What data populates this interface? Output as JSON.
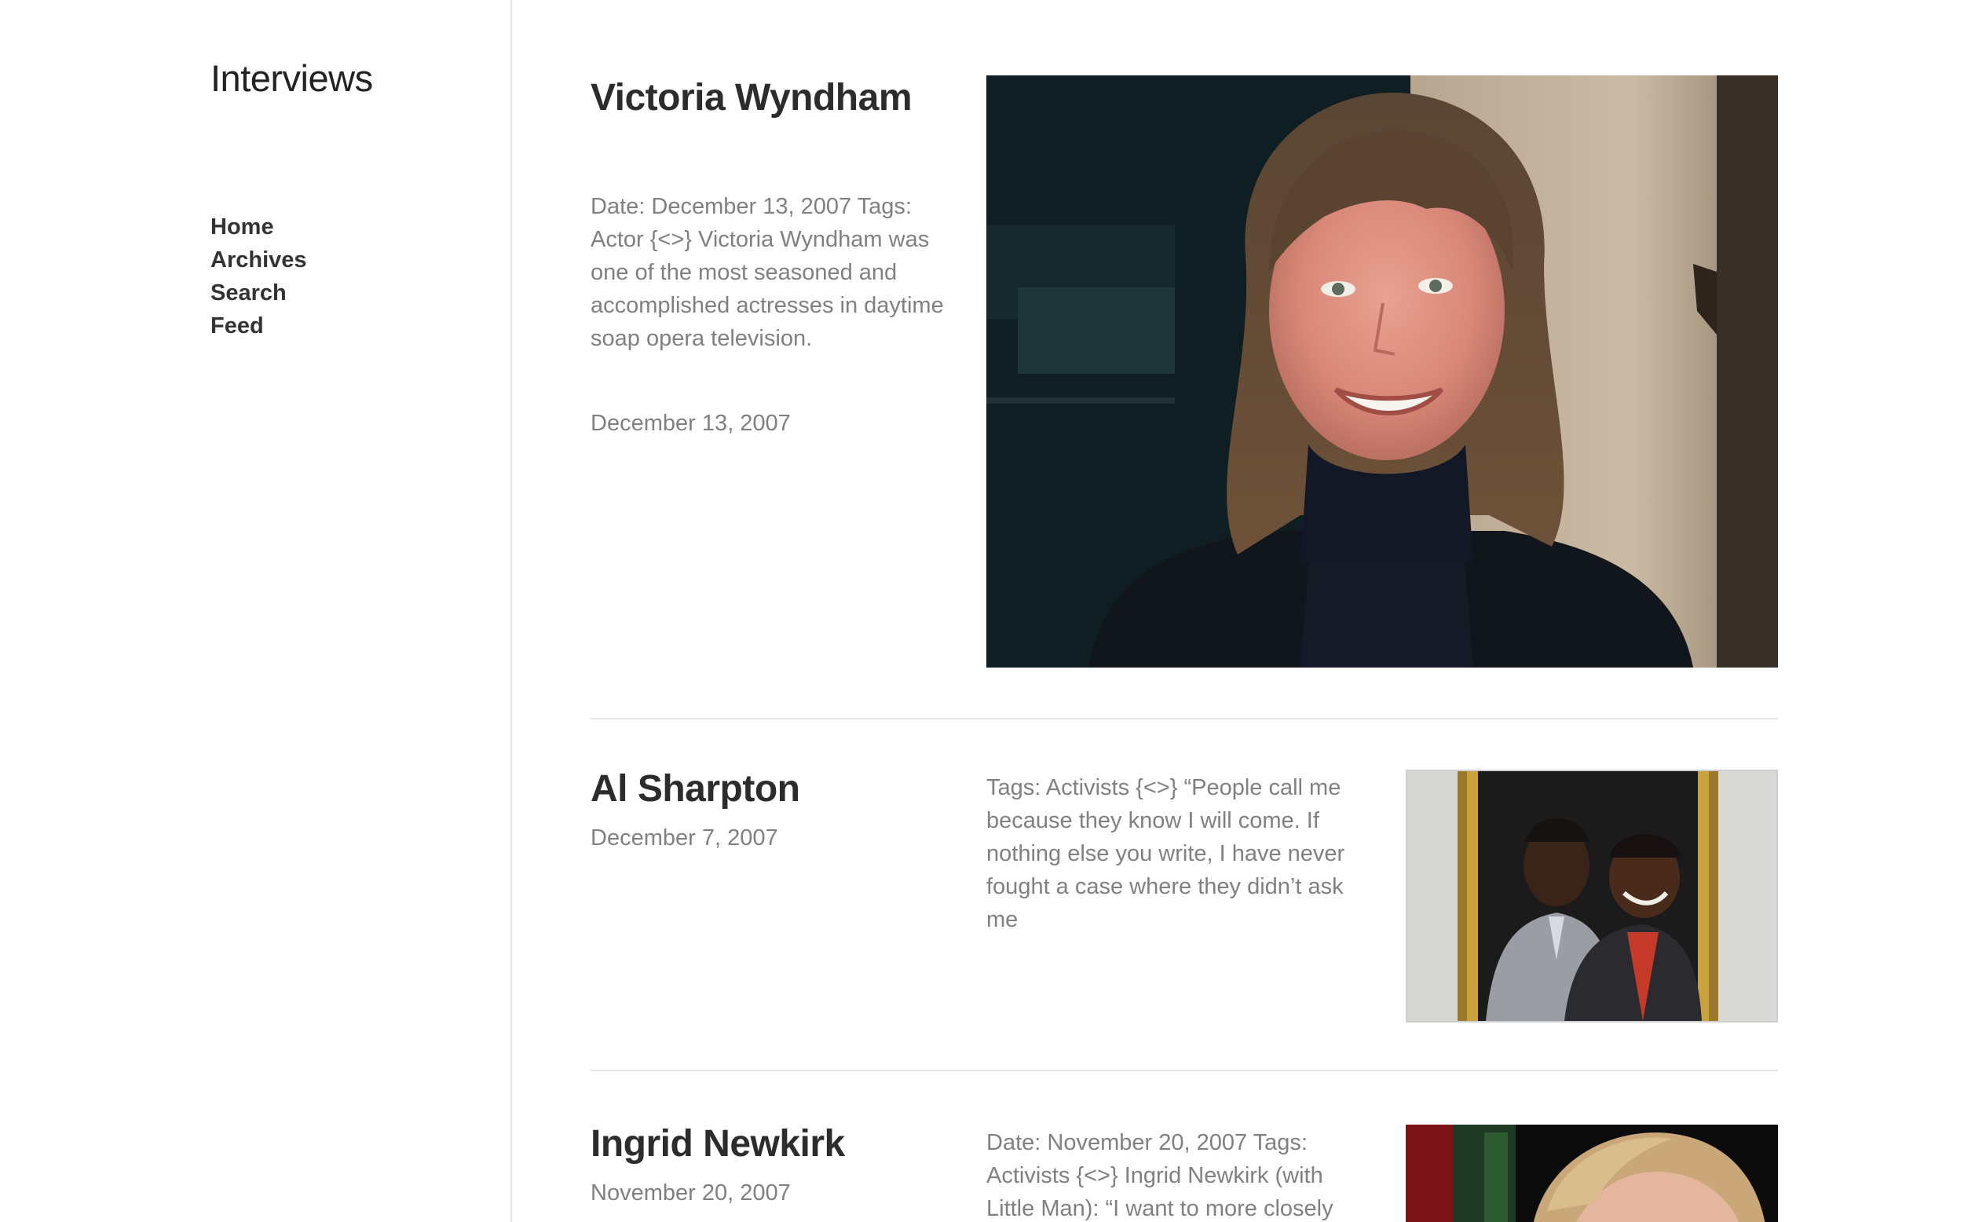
{
  "site": {
    "title": "Interviews"
  },
  "nav": {
    "items": [
      {
        "label": "Home"
      },
      {
        "label": "Archives"
      },
      {
        "label": "Search"
      },
      {
        "label": "Feed"
      }
    ]
  },
  "posts": [
    {
      "title": "Victoria Wyndham",
      "excerpt": "Date: December 13, 2007 Tags: Actor {<>} Victoria Wyndham was one of the most seasoned and accomplished actresses in daytime soap opera television.",
      "date": "December 13, 2007",
      "image": "portrait photo of a smiling woman with shoulder-length brown hair and bangs"
    },
    {
      "title": "Al Sharpton",
      "date": "December 7, 2007",
      "excerpt": "Tags: Activists {<>} “People call me because they know I will come. If nothing else you write, I have never fought a case where they didn’t ask me",
      "image": "framed photo of two men in suits"
    },
    {
      "title": "Ingrid Newkirk",
      "date": "November 20, 2007",
      "excerpt": "Date: November 20, 2007 Tags: Activists {<>} Ingrid Newkirk (with Little Man): “I want to more closely",
      "image": "photo of a woman with light blond hair"
    }
  ],
  "colors": {
    "text_dark": "#2c2c2c",
    "text_muted": "#808080",
    "divider": "#e6e6e6",
    "background": "#ffffff"
  }
}
